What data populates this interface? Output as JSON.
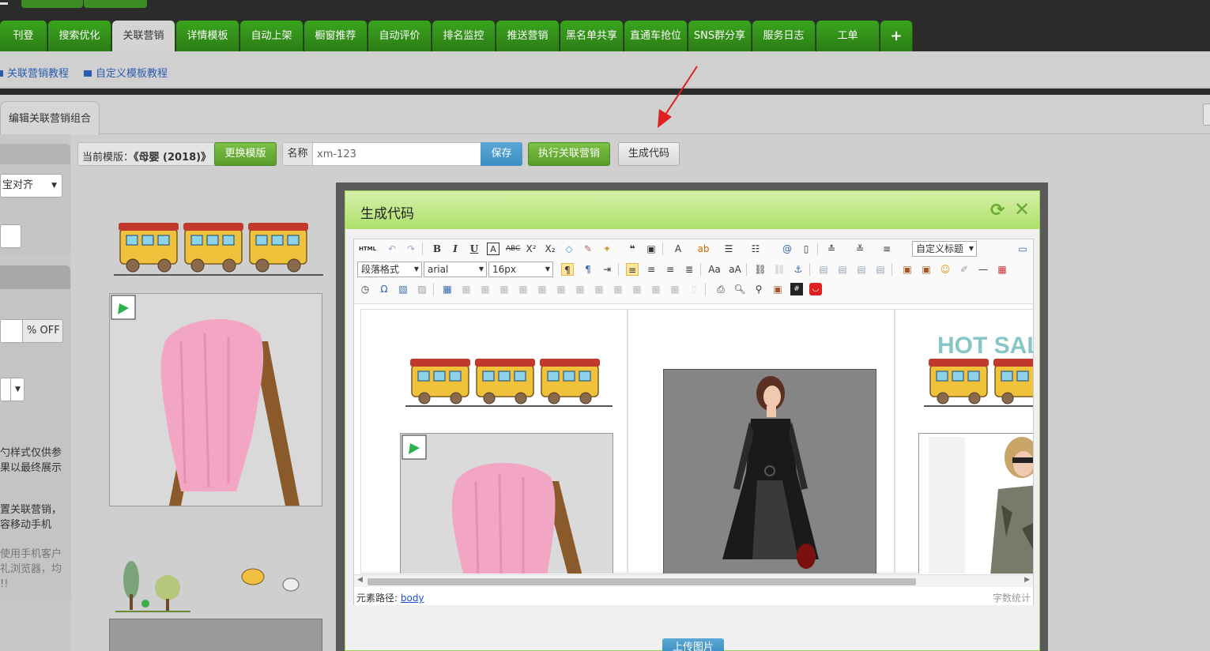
{
  "nav": {
    "tabs": [
      "刊登",
      "搜索优化",
      "关联营销",
      "详情模板",
      "自动上架",
      "橱窗推荐",
      "自动评价",
      "排名监控",
      "推送营销",
      "黑名单共享",
      "直通车抢位",
      "SNS群分享",
      "服务日志",
      "工单",
      "+"
    ],
    "active_index": 2
  },
  "links": {
    "tutorial1": "关联营销教程",
    "tutorial2": "自定义模板教程"
  },
  "tab": {
    "label": "编辑关联营销组合"
  },
  "toolbar": {
    "template_prefix": "当前模版：",
    "template_name": "《母婴 (2018)》",
    "change_template": "更换模版",
    "name_label": "名称",
    "name_value": "xm-123",
    "save": "保存",
    "execute": "执行关联营销",
    "generate": "生成代码"
  },
  "sidebar": {
    "align_select": "宝对齐",
    "discount_unit": "% OFF",
    "note1_l1": "勺样式仅供参",
    "note1_l2": "果以最终展示",
    "note2_l1": "置关联营销，",
    "note2_l2": "容移动手机",
    "note3_l1": "使用手机客户",
    "note3_l2": "礼浏览器，均",
    "note3_l3": "!!"
  },
  "modal": {
    "title": "生成代码",
    "editor": {
      "paragraph_format": "段落格式",
      "font_family": "arial",
      "font_size": "16px",
      "custom_title": "自定义标题",
      "html_label": "HTML"
    },
    "content": {
      "hot_sale": "HOT SAL"
    },
    "status": {
      "path_label": "元素路径:",
      "path_value": "body",
      "word_count": "字数统计"
    },
    "upload": "上传图片"
  },
  "colors": {
    "nav_green": "#3aa51d",
    "button_green": "#6cb035",
    "button_blue": "#4a9acb",
    "modal_header": "#c3e88f",
    "arrow_red": "#e02020"
  }
}
